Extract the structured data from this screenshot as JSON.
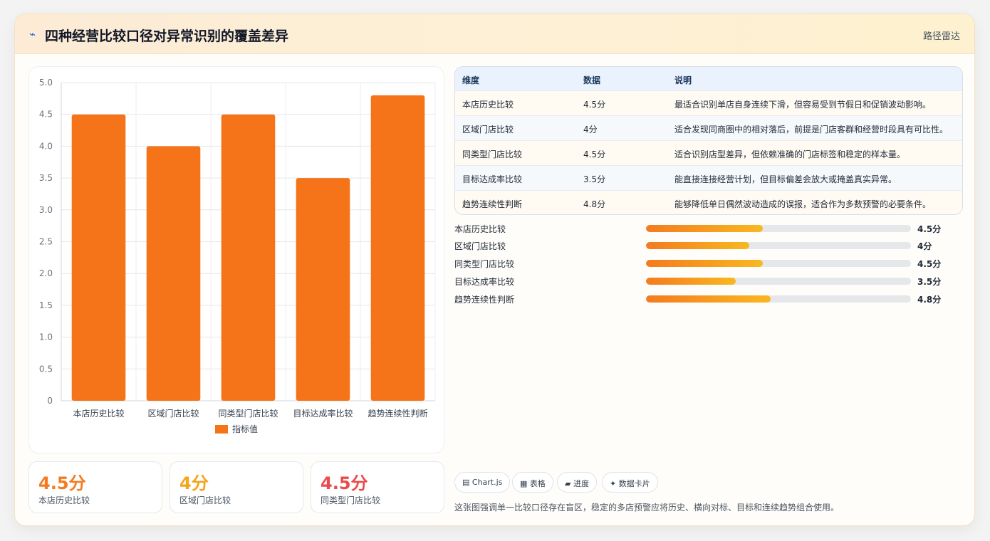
{
  "header": {
    "icon": "bolt-icon",
    "title": "四种经营比较口径对异常识别的覆盖差异",
    "tag": "路径雷达"
  },
  "chart_data": {
    "type": "bar",
    "categories": [
      "本店历史比较",
      "区域门店比较",
      "同类型门店比较",
      "目标达成率比较",
      "趋势连续性判断"
    ],
    "series": [
      {
        "name": "指标值",
        "values": [
          4.5,
          4,
          4.5,
          3.5,
          4.8
        ]
      }
    ],
    "ylim": [
      0,
      5
    ],
    "yticks": [
      "0",
      "0.5",
      "1.0",
      "1.5",
      "2.0",
      "2.5",
      "3.0",
      "3.5",
      "4.0",
      "4.5",
      "5.0"
    ],
    "bar_color": "#f5741a",
    "grid": true,
    "legend": "bottom"
  },
  "stats": [
    {
      "value": "4.5分",
      "label": "本店历史比较",
      "color": "#f47b20"
    },
    {
      "value": "4分",
      "label": "区域门店比较",
      "color": "#f3a51b"
    },
    {
      "value": "4.5分",
      "label": "同类型门店比较",
      "color": "#e94b4b"
    }
  ],
  "table": {
    "headers": [
      "维度",
      "数据",
      "说明"
    ],
    "rows": [
      [
        "本店历史比较",
        "4.5分",
        "最适合识别单店自身连续下滑，但容易受到节假日和促销波动影响。"
      ],
      [
        "区域门店比较",
        "4分",
        "适合发现同商圈中的相对落后，前提是门店客群和经营时段具有可比性。"
      ],
      [
        "同类型门店比较",
        "4.5分",
        "适合识别店型差异，但依赖准确的门店标签和稳定的样本量。"
      ],
      [
        "目标达成率比较",
        "3.5分",
        "能直接连接经营计划，但目标偏差会放大或掩盖真实异常。"
      ],
      [
        "趋势连续性判断",
        "4.8分",
        "能够降低单日偶然波动造成的误报，适合作为多数预警的必要条件。"
      ]
    ]
  },
  "progress": [
    {
      "label": "本店历史比较",
      "value": "4.5分",
      "fraction": 0.44
    },
    {
      "label": "区域门店比较",
      "value": "4分",
      "fraction": 0.39
    },
    {
      "label": "同类型门店比较",
      "value": "4.5分",
      "fraction": 0.44
    },
    {
      "label": "目标达成率比较",
      "value": "3.5分",
      "fraction": 0.34
    },
    {
      "label": "趋势连续性判断",
      "value": "4.8分",
      "fraction": 0.47
    }
  ],
  "chips": [
    "▤ Chart.js",
    "▦ 表格",
    "▰ 进度",
    "✦ 数据卡片"
  ],
  "footer_note": "这张图强调单一比较口径存在盲区，稳定的多店预警应将历史、横向对标、目标和连续趋势组合使用。"
}
